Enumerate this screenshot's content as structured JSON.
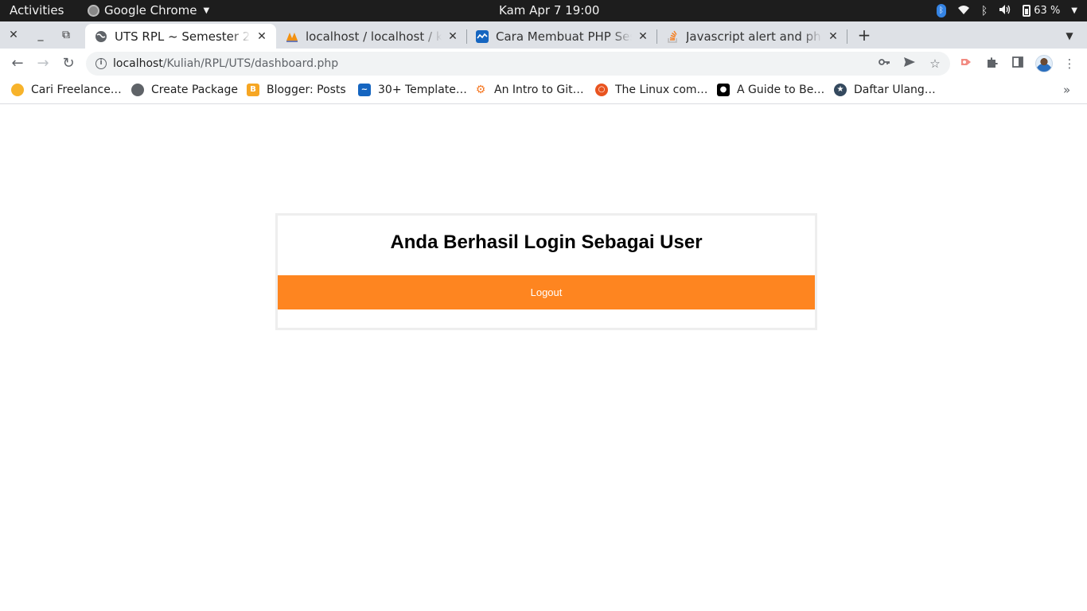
{
  "system_bar": {
    "activities": "Activities",
    "app_name": "Google Chrome",
    "clock": "Kam Apr 7  19:00",
    "battery": "63 %",
    "icons": [
      "bluetooth-icon",
      "wifi-icon",
      "bluetooth-icon",
      "volume-icon",
      "battery-icon",
      "chevron-down-icon"
    ]
  },
  "tabs": [
    {
      "title": "UTS RPL ~ Semester 2",
      "active": true,
      "favicon": "globe-icon"
    },
    {
      "title": "localhost / localhost / kuli",
      "active": false,
      "favicon": "phpmyadmin-icon"
    },
    {
      "title": "Cara Membuat PHP Sessio",
      "active": false,
      "favicon": "malasngoding-icon"
    },
    {
      "title": "Javascript alert and php h",
      "active": false,
      "favicon": "stackoverflow-icon"
    }
  ],
  "toolbar": {
    "url_host": "localhost",
    "url_path": "/Kuliah/RPL/UTS/dashboard.php"
  },
  "bookmarks": [
    {
      "label": "Cari Freelance…",
      "icon": "freelance-icon",
      "color": "#f7b32b"
    },
    {
      "label": "Create Package",
      "icon": "globe-icon",
      "color": "#5f6368"
    },
    {
      "label": "Blogger: Posts",
      "icon": "blogger-icon",
      "color": "#f6a623"
    },
    {
      "label": "30+ Template…",
      "icon": "malasngoding-icon",
      "color": "#1565c0"
    },
    {
      "label": "An Intro to Git…",
      "icon": "hubspot-icon",
      "color": "#f57722"
    },
    {
      "label": "The Linux com…",
      "icon": "ubuntu-icon",
      "color": "#e95420"
    },
    {
      "label": "A Guide to Be…",
      "icon": "medium-icon",
      "color": "#000000"
    },
    {
      "label": "Daftar Ulang…",
      "icon": "university-icon",
      "color": "#34495e"
    }
  ],
  "page": {
    "heading": "Anda Berhasil Login Sebagai User",
    "logout_label": "Logout",
    "accent_color": "#fe8520"
  }
}
